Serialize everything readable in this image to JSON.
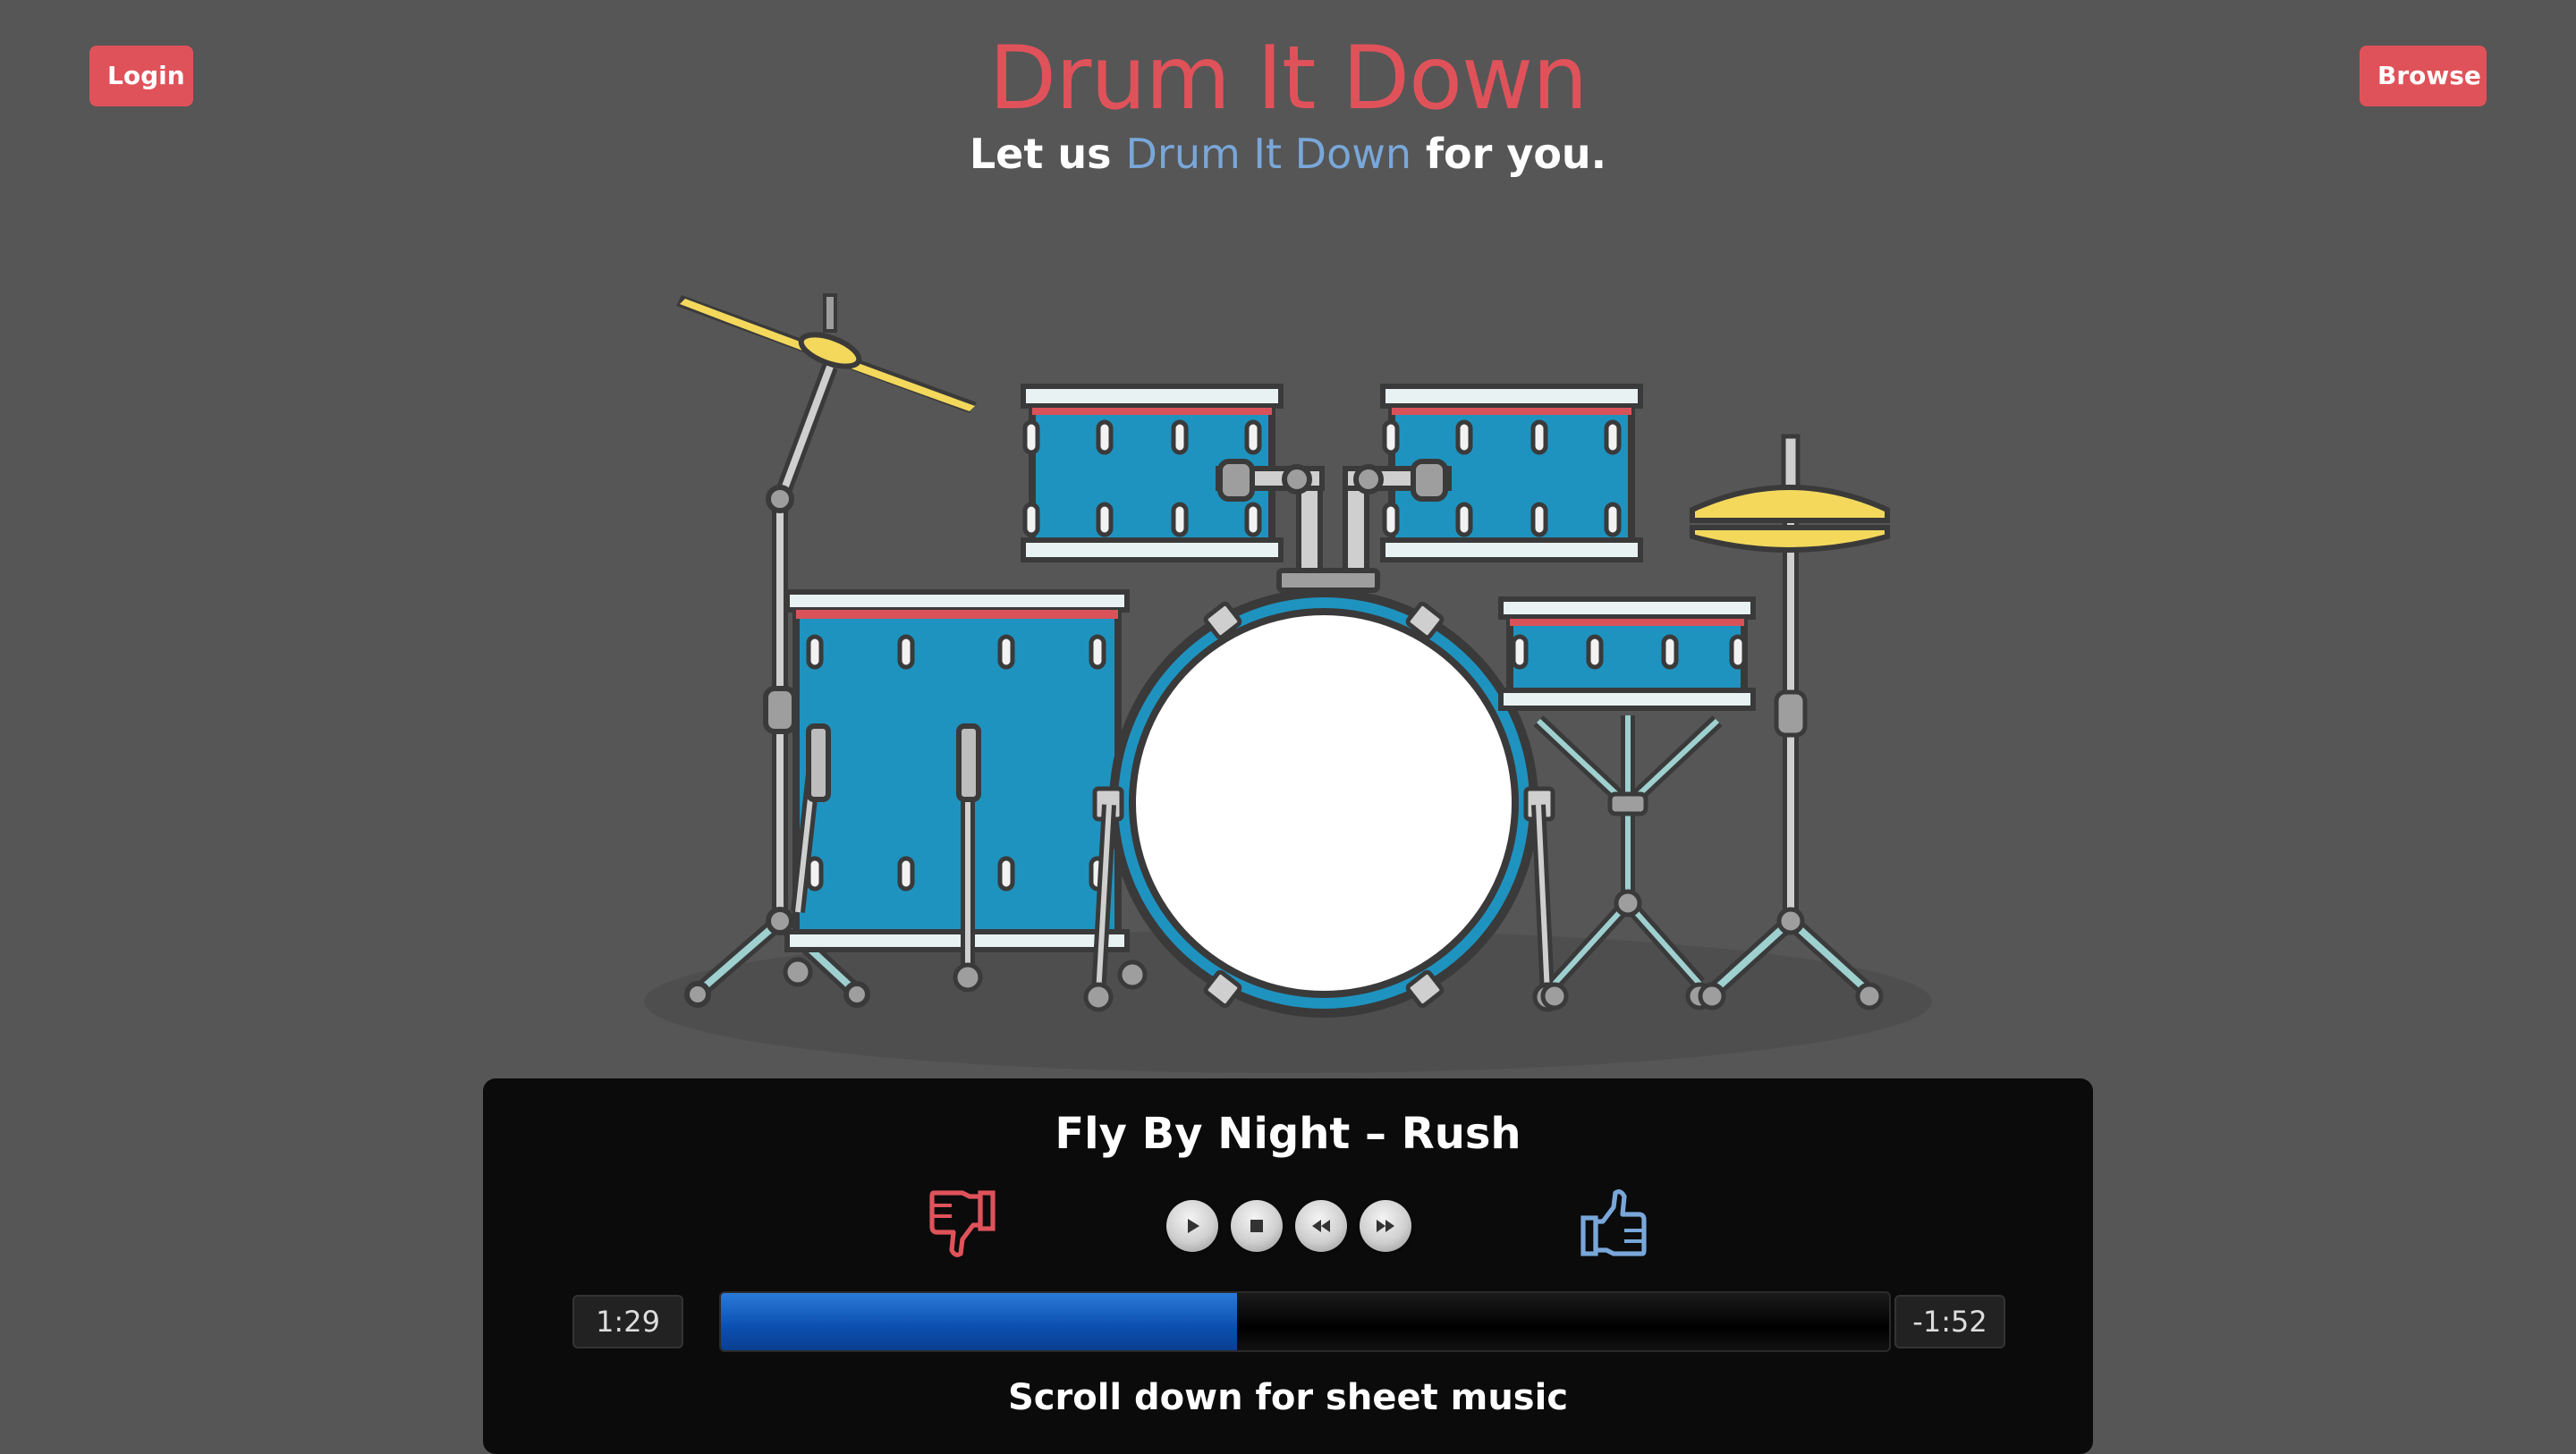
{
  "header": {
    "login_label": "Login",
    "browse_label": "Browse",
    "title": "Drum It Down",
    "subtitle_before": "Let us",
    "subtitle_accent": "Drum It Down",
    "subtitle_after": "for you."
  },
  "player": {
    "song": "Fly By Night – Rush",
    "time_elapsed": "1:29",
    "time_remaining": "-1:52",
    "progress": 0.4415,
    "hint": "Scroll down for sheet music",
    "controls": [
      "play-icon",
      "stop-icon",
      "rewind-icon",
      "fast-forward-icon"
    ],
    "icons": [
      "thumbs-down-icon",
      "thumbs-up-icon"
    ]
  },
  "colors": {
    "background": "#565656",
    "accent_red": "#e0525a",
    "accent_blue": "#79a7d9",
    "drum_blue": "#1f93bf",
    "player_bg": "#0b0b0b",
    "progress_fill": "#1560c9"
  }
}
